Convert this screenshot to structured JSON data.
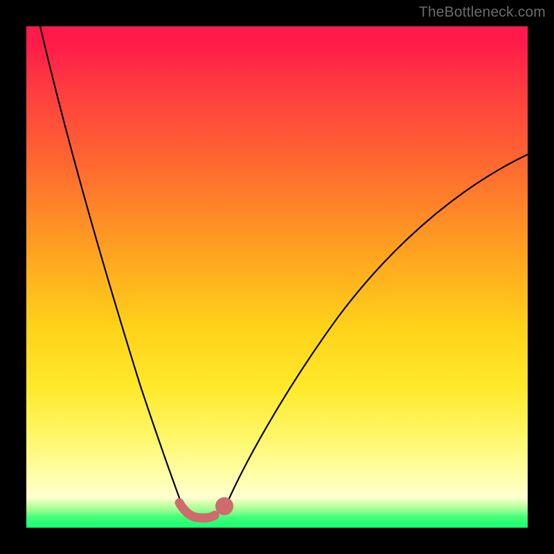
{
  "watermark": "TheBottleneck.com",
  "colors": {
    "frame": "#000000",
    "curve": "#000000",
    "marker": "#cf6a6d",
    "gradient_top": "#ff1a4b",
    "gradient_bottom": "#1aff70"
  },
  "chart_data": {
    "type": "line",
    "title": "",
    "xlabel": "",
    "ylabel": "",
    "xlim": [
      0,
      100
    ],
    "ylim": [
      0,
      100
    ],
    "grid": false,
    "legend": false,
    "note": "Axes carry no numeric tick labels in the image; values are estimated to the nearest percent from pixel position where 0=left/bottom and 100=right/top.",
    "series": [
      {
        "name": "curve_left",
        "type": "line",
        "x": [
          3,
          5,
          7,
          9,
          11,
          13,
          15,
          17,
          19,
          21,
          23,
          25,
          27,
          28,
          29,
          30,
          31,
          32
        ],
        "y": [
          100,
          91,
          82,
          73,
          64,
          56,
          48,
          41,
          34,
          28,
          22,
          17,
          12,
          9,
          7,
          5,
          4,
          3
        ]
      },
      {
        "name": "curve_right",
        "type": "line",
        "x": [
          39,
          40,
          42,
          45,
          49,
          54,
          60,
          66,
          73,
          80,
          87,
          94,
          100
        ],
        "y": [
          3,
          4,
          6,
          10,
          16,
          23,
          31,
          39,
          47,
          55,
          62,
          69,
          74
        ]
      },
      {
        "name": "valley_markers",
        "type": "scatter",
        "x": [
          30.5,
          31.5,
          32.5,
          33.5,
          35.0,
          36.5,
          37.5,
          38.5,
          39.5
        ],
        "y": [
          5.0,
          3.8,
          2.8,
          2.2,
          2.0,
          2.2,
          2.8,
          3.8,
          5.0
        ]
      }
    ]
  }
}
